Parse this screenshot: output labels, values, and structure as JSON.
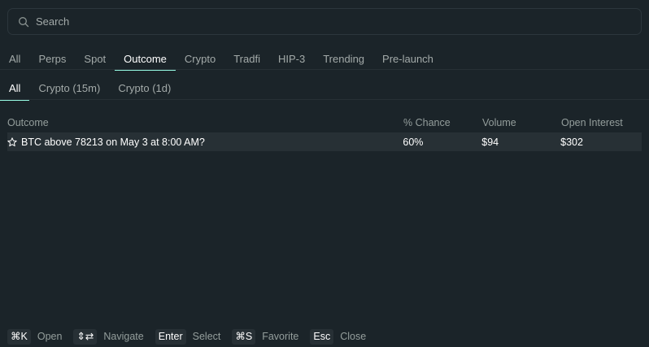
{
  "search": {
    "placeholder": "Search"
  },
  "main_tabs": [
    "All",
    "Perps",
    "Spot",
    "Outcome",
    "Crypto",
    "Tradfi",
    "HIP-3",
    "Trending",
    "Pre-launch"
  ],
  "main_tabs_active": "Outcome",
  "sub_tabs": [
    "All",
    "Crypto (15m)",
    "Crypto (1d)"
  ],
  "sub_tabs_active": "All",
  "table": {
    "headers": {
      "outcome": "Outcome",
      "chance": "% Chance",
      "volume": "Volume",
      "open_interest": "Open Interest"
    },
    "rows": [
      {
        "outcome": "BTC above 78213 on May 3 at 8:00 AM?",
        "chance": "60%",
        "volume": "$94",
        "open_interest": "$302",
        "icon": "star-outline-icon"
      }
    ]
  },
  "footer": [
    {
      "key": "⌘K",
      "label": "Open"
    },
    {
      "key": "⇕⇄",
      "label": "Navigate"
    },
    {
      "key": "Enter",
      "label": "Select"
    },
    {
      "key": "⌘S",
      "label": "Favorite"
    },
    {
      "key": "Esc",
      "label": "Close"
    }
  ],
  "colors": {
    "background": "#1b2429",
    "accent": "#97fce4",
    "row_highlight": "#273035",
    "border": "#2c363c"
  }
}
